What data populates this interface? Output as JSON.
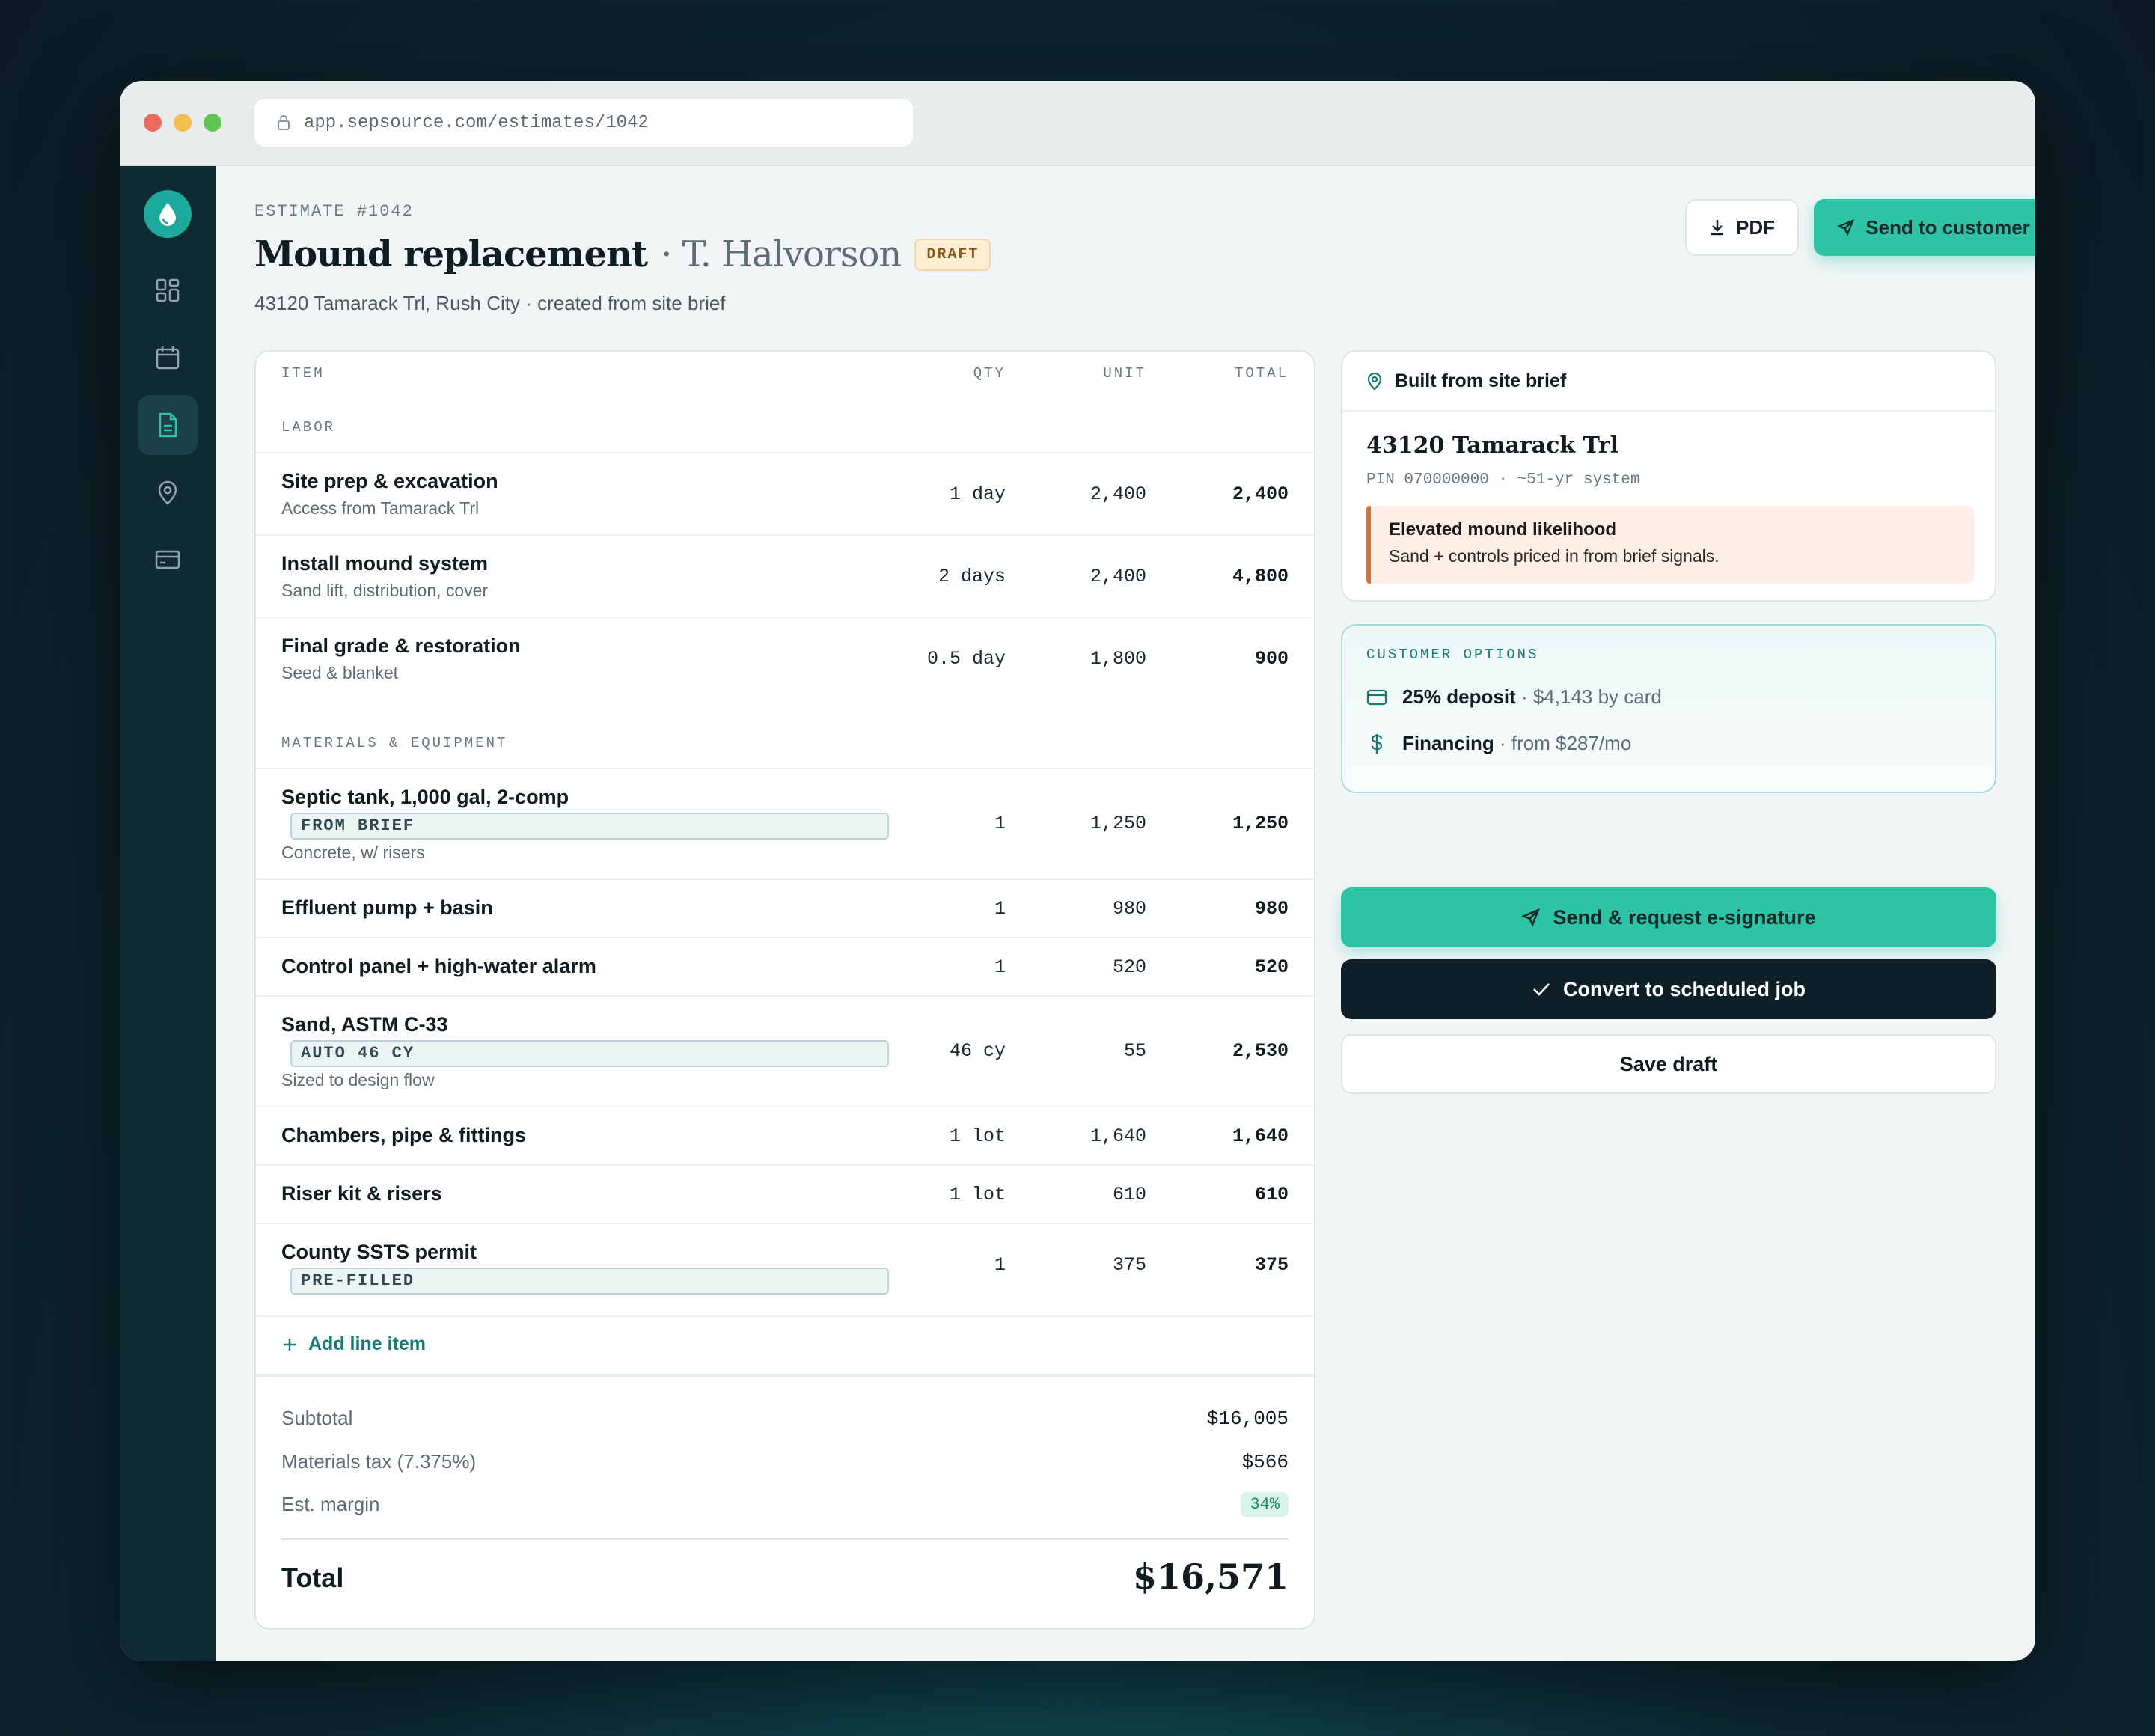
{
  "browser": {
    "url": "app.sepsource.com/estimates/1042"
  },
  "header": {
    "estimate_no": "ESTIMATE #1042",
    "title": "Mound replacement",
    "customer": "· T. Halvorson",
    "status_badge": "DRAFT",
    "subtitle": "43120 Tamarack Trl, Rush City · created from site brief",
    "pdf_label": "PDF",
    "send_label": "Send to customer"
  },
  "table": {
    "columns": [
      "ITEM",
      "QTY",
      "UNIT",
      "TOTAL"
    ],
    "sections": [
      {
        "label": "LABOR"
      },
      {
        "label": "MATERIALS & EQUIPMENT"
      }
    ],
    "rows": [
      {
        "name": "Site prep & excavation",
        "note": "Access from Tamarack Trl",
        "qty": "1 day",
        "unit": "2,400",
        "total": "2,400"
      },
      {
        "name": "Install mound system",
        "note": "Sand lift, distribution, cover",
        "qty": "2 days",
        "unit": "2,400",
        "total": "4,800"
      },
      {
        "name": "Final grade & restoration",
        "note": "Seed & blanket",
        "qty": "0.5 day",
        "unit": "1,800",
        "total": "900"
      },
      {
        "name": "Septic tank, 1,000 gal, 2-comp",
        "tag": "FROM BRIEF",
        "note": "Concrete, w/ risers",
        "qty": "1",
        "unit": "1,250",
        "total": "1,250"
      },
      {
        "name": "Effluent pump + basin",
        "qty": "1",
        "unit": "980",
        "total": "980"
      },
      {
        "name": "Control panel + high-water alarm",
        "qty": "1",
        "unit": "520",
        "total": "520"
      },
      {
        "name": "Sand, ASTM C-33",
        "tag": "AUTO 46 CY",
        "note": "Sized to design flow",
        "qty": "46 cy",
        "unit": "55",
        "total": "2,530"
      },
      {
        "name": "Chambers, pipe & fittings",
        "qty": "1 lot",
        "unit": "1,640",
        "total": "1,640"
      },
      {
        "name": "Riser kit & risers",
        "qty": "1 lot",
        "unit": "610",
        "total": "610"
      },
      {
        "name": "County SSTS permit",
        "tag": "PRE-FILLED",
        "qty": "1",
        "unit": "375",
        "total": "375"
      }
    ],
    "add_line_label": "Add line item"
  },
  "totals": {
    "subtotal_label": "Subtotal",
    "subtotal": "$16,005",
    "tax_label": "Materials tax (7.375%)",
    "tax": "$566",
    "margin_label": "Est. margin",
    "margin": "34%",
    "total_label": "Total",
    "total": "$16,571"
  },
  "brief": {
    "heading": "Built from site brief",
    "address": "43120 Tamarack Trl",
    "pin": "PIN 070000000 · ~51-yr system",
    "alert_title": "Elevated mound likelihood",
    "alert_body": "Sand + controls priced in from brief signals."
  },
  "options": {
    "label": "CUSTOMER OPTIONS",
    "deposit_bold": "25% deposit",
    "deposit_rest": "· $4,143 by card",
    "financing_bold": "Financing",
    "financing_rest": "· from $287/mo"
  },
  "actions": {
    "esign": "Send & request e-signature",
    "convert": "Convert to scheduled job",
    "save": "Save draft"
  },
  "colors": {
    "accent": "#2cc4a5",
    "sidebar": "#0f2a30",
    "dark_button": "#0f1f27",
    "alert": "#d9743e"
  }
}
